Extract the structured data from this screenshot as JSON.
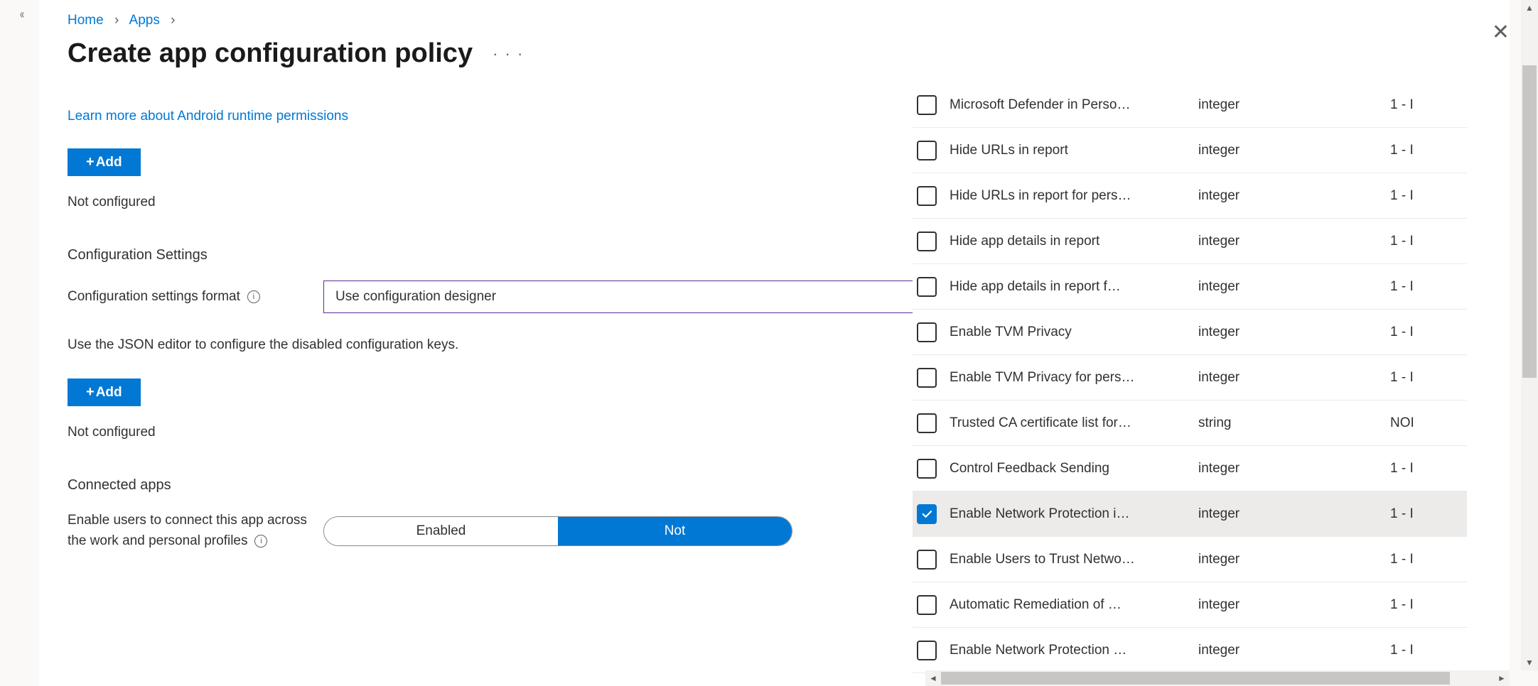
{
  "breadcrumb": {
    "home": "Home",
    "apps": "Apps"
  },
  "page_title": "Create app configuration policy",
  "learn_link": "Learn more about Android runtime permissions",
  "add_label": "Add",
  "not_configured": "Not configured",
  "section_config_settings": "Configuration Settings",
  "config_format_label": "Configuration settings format",
  "config_format_value": "Use configuration designer",
  "json_helper": "Use the JSON editor to configure the disabled configuration keys.",
  "section_connected_apps": "Connected apps",
  "connected_apps_desc_l1": "Enable users to connect this app across",
  "connected_apps_desc_l2": "the work and personal profiles",
  "toggle": {
    "enabled": "Enabled",
    "not_label": "Not"
  },
  "settings_rows": [
    {
      "name": "Microsoft Defender in Perso…",
      "type": "integer",
      "value": "1 - I",
      "checked": false
    },
    {
      "name": "Hide URLs in report",
      "type": "integer",
      "value": "1 - I",
      "checked": false
    },
    {
      "name": "Hide URLs in report for pers…",
      "type": "integer",
      "value": "1 - I",
      "checked": false
    },
    {
      "name": "Hide app details in report",
      "type": "integer",
      "value": "1 - I",
      "checked": false
    },
    {
      "name": "Hide app details in report f…",
      "type": "integer",
      "value": "1 - I",
      "checked": false
    },
    {
      "name": "Enable TVM Privacy",
      "type": "integer",
      "value": "1 - I",
      "checked": false
    },
    {
      "name": "Enable TVM Privacy for pers…",
      "type": "integer",
      "value": "1 - I",
      "checked": false
    },
    {
      "name": "Trusted CA certificate list for…",
      "type": "string",
      "value": "NOI",
      "checked": false
    },
    {
      "name": "Control Feedback Sending",
      "type": "integer",
      "value": "1 - I",
      "checked": false
    },
    {
      "name": "Enable Network Protection i…",
      "type": "integer",
      "value": "1 - I",
      "checked": true
    },
    {
      "name": "Enable Users to Trust Netwo…",
      "type": "integer",
      "value": "1 - I",
      "checked": false
    },
    {
      "name": "Automatic Remediation of …",
      "type": "integer",
      "value": "1 - I",
      "checked": false
    },
    {
      "name": "Enable Network Protection …",
      "type": "integer",
      "value": "1 - I",
      "checked": false
    }
  ]
}
